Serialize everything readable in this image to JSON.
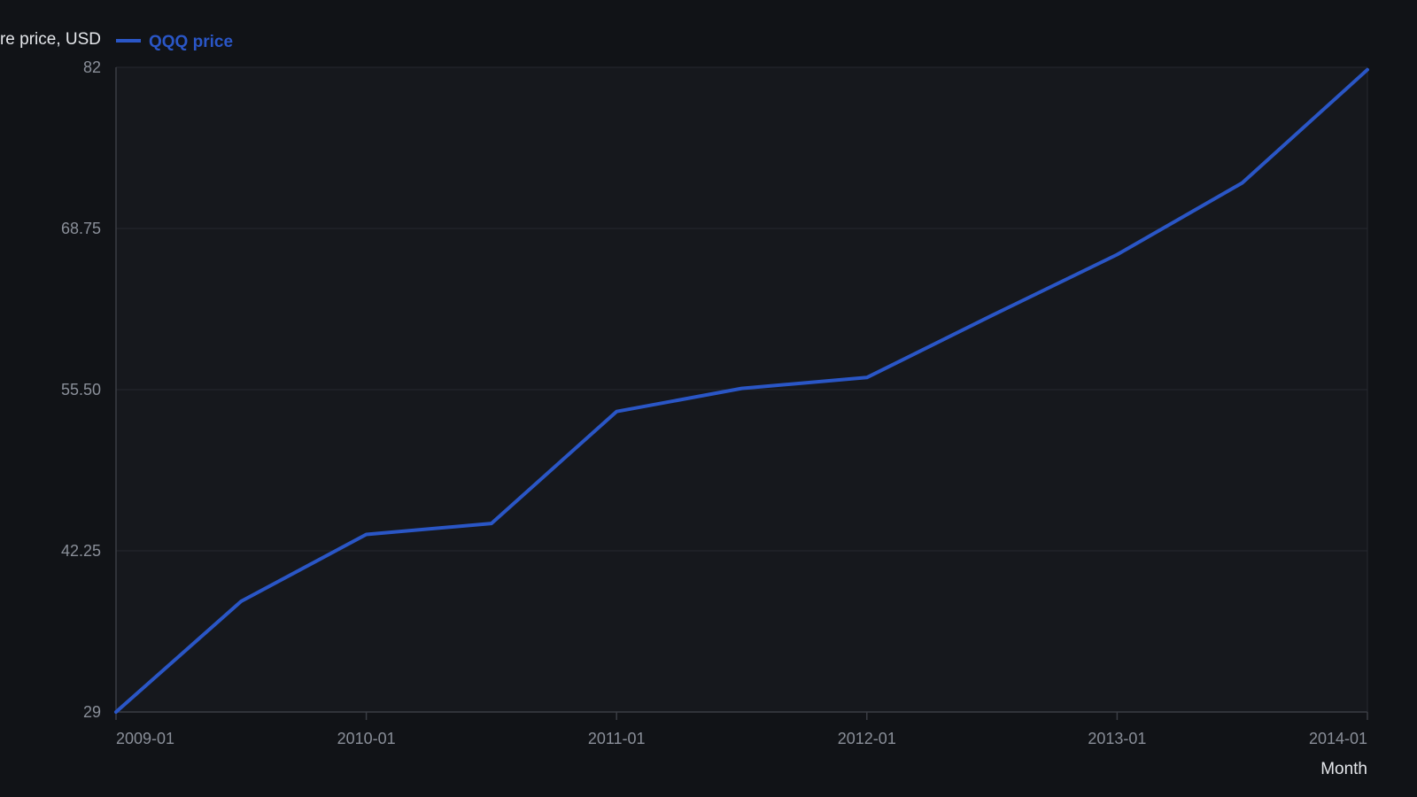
{
  "chart_data": {
    "type": "line",
    "title": "",
    "ylabel": "re price, USD",
    "xlabel": "Month",
    "x": [
      "2009-01",
      "2009-07",
      "2010-01",
      "2010-07",
      "2011-01",
      "2011-07",
      "2012-01",
      "2012-07",
      "2013-01",
      "2013-07",
      "2014-01"
    ],
    "series": [
      {
        "name": "QQQ price",
        "color": "#2a56c6",
        "values": [
          29.0,
          38.1,
          43.6,
          44.5,
          53.7,
          55.6,
          56.5,
          61.6,
          66.6,
          72.5,
          81.8
        ]
      }
    ],
    "ylim": [
      29,
      82
    ],
    "yticks": [
      "29",
      "42.25",
      "55.50",
      "68.75",
      "82"
    ],
    "xticks": [
      "2009-01",
      "2010-01",
      "2011-01",
      "2012-01",
      "2013-01",
      "2014-01"
    ],
    "grid": true,
    "legend": "top-left"
  },
  "colors": {
    "background": "#111317",
    "plot_background": "#16181d",
    "grid": "#262930",
    "axis": "#3a3d44",
    "tick_text": "#8a8f99",
    "title_text": "#e4e6ea"
  }
}
